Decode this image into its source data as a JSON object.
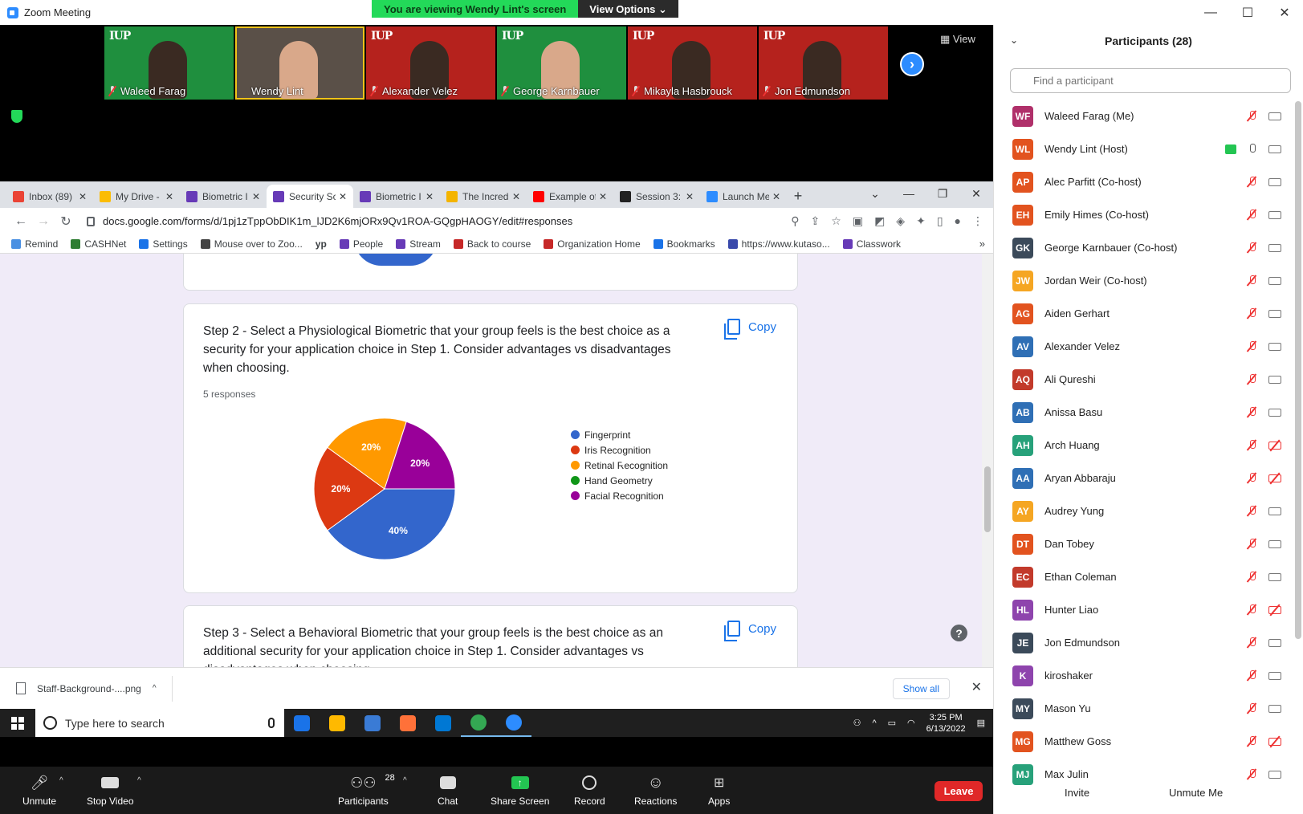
{
  "zoom": {
    "window_title": "Zoom Meeting",
    "banner_text": "You are viewing Wendy Lint's screen",
    "view_options": "View Options",
    "view_label": "View",
    "min": "—",
    "max": "☐",
    "close": "✕"
  },
  "thumbnails": [
    {
      "name": "Waleed Farag",
      "bg": "green",
      "iup": "IUP",
      "light": false,
      "speaking": false,
      "muted": true
    },
    {
      "name": "Wendy Lint",
      "bg": "room",
      "iup": "",
      "light": true,
      "speaking": true,
      "muted": false
    },
    {
      "name": "Alexander Velez",
      "bg": "red",
      "iup": "IUP",
      "light": false,
      "speaking": false,
      "muted": true
    },
    {
      "name": "George Karnbauer",
      "bg": "green",
      "iup": "IUP",
      "light": true,
      "speaking": false,
      "muted": true
    },
    {
      "name": "Mikayla Hasbrouck",
      "bg": "red",
      "iup": "IUP",
      "light": false,
      "speaking": false,
      "muted": true
    },
    {
      "name": "Jon Edmundson",
      "bg": "red",
      "iup": "IUP",
      "light": false,
      "speaking": false,
      "muted": true
    }
  ],
  "browser": {
    "tabs": [
      {
        "label": "Inbox (89)",
        "color": "#ea4335",
        "active": false
      },
      {
        "label": "My Drive -",
        "color": "#fbbc04",
        "active": false
      },
      {
        "label": "Biometric I",
        "color": "#673ab7",
        "active": false
      },
      {
        "label": "Security Sc",
        "color": "#673ab7",
        "active": true
      },
      {
        "label": "Biometric I",
        "color": "#673ab7",
        "active": false
      },
      {
        "label": "The Incred",
        "color": "#f4b400",
        "active": false
      },
      {
        "label": "Example of",
        "color": "#ff0000",
        "active": false
      },
      {
        "label": "Session 3:",
        "color": "#222222",
        "active": false
      },
      {
        "label": "Launch Me",
        "color": "#2d8cff",
        "active": false
      }
    ],
    "new_tab": "+",
    "url": "docs.google.com/forms/d/1pj1zTppObDIK1m_lJD2K6mjORx9Qv1ROA-GQgpHAOGY/edit#responses",
    "bookmarks": [
      {
        "label": "Remind",
        "color": "#4a90e2"
      },
      {
        "label": "CASHNet",
        "color": "#2e7d32"
      },
      {
        "label": "Settings",
        "color": "#1a73e8"
      },
      {
        "label": "Mouse over to Zoo...",
        "color": "#444444"
      },
      {
        "label": "",
        "color": "#222222",
        "text": "yp"
      },
      {
        "label": "People",
        "color": "#673ab7"
      },
      {
        "label": "Stream",
        "color": "#673ab7"
      },
      {
        "label": "Back to course",
        "color": "#c62828"
      },
      {
        "label": "Organization Home",
        "color": "#c62828"
      },
      {
        "label": "Bookmarks",
        "color": "#1a73e8"
      },
      {
        "label": "https://www.kutaso...",
        "color": "#3949ab"
      },
      {
        "label": "Classwork",
        "color": "#673ab7"
      }
    ],
    "bookmarks_more": "»"
  },
  "form": {
    "step2": {
      "question": "Step 2 - Select a Physiological Biometric that your group feels is the best choice as a security for your  application choice in Step 1. Consider advantages vs disadvantages when choosing.",
      "responses": "5 responses",
      "copy_label": "Copy"
    },
    "step3": {
      "question": "Step 3 - Select a Behavioral Biometric that your group feels is the best choice as an additional security for your  application choice in Step 1. Consider advantages vs disadvantages when choosing.",
      "copy_label": "Copy"
    },
    "help": "?"
  },
  "chart_data": {
    "type": "pie",
    "categories": [
      "Fingerprint",
      "Iris Recognition",
      "Retinal Recognition",
      "Hand Geometry",
      "Facial Recognition"
    ],
    "values": [
      40,
      20,
      20,
      0,
      20
    ],
    "labels": [
      "40%",
      "20%",
      "20%",
      "",
      "20%"
    ],
    "colors": [
      "#3366cc",
      "#dc3912",
      "#ff9900",
      "#109618",
      "#990099"
    ],
    "legend_position": "right"
  },
  "download": {
    "filename": "Staff-Background-....png",
    "show_all": "Show all",
    "close": "✕"
  },
  "taskbar": {
    "search_placeholder": "Type here to search",
    "time": "3:25 PM",
    "date": "6/13/2022",
    "apps": [
      "#1a73e8",
      "#ffb900",
      "#3a7bd5",
      "#ff7139",
      "#0078d4",
      "#34a853",
      "#2d8cff"
    ]
  },
  "controls": {
    "unmute": "Unmute",
    "stop_video": "Stop Video",
    "participants": "Participants",
    "participants_count": "28",
    "chat": "Chat",
    "share_screen": "Share Screen",
    "record": "Record",
    "reactions": "Reactions",
    "apps": "Apps",
    "leave": "Leave"
  },
  "panel": {
    "title": "Participants (28)",
    "search_placeholder": "Find a participant",
    "invite": "Invite",
    "unmute_me": "Unmute Me",
    "participants": [
      {
        "initials": "WF",
        "name": "Waleed Farag (Me)",
        "color": "#b0306a",
        "cam_off": false,
        "share": false
      },
      {
        "initials": "WL",
        "name": "Wendy Lint (Host)",
        "color": "#e2531f",
        "cam_off": false,
        "share": true
      },
      {
        "initials": "AP",
        "name": "Alec Parfitt (Co-host)",
        "color": "#e2531f",
        "cam_off": false,
        "share": false
      },
      {
        "initials": "EH",
        "name": "Emily Himes (Co-host)",
        "color": "#e2531f",
        "cam_off": false,
        "share": false
      },
      {
        "initials": "GK",
        "name": "George Karnbauer (Co-host)",
        "color": "#3b4a5a",
        "cam_off": false,
        "share": false
      },
      {
        "initials": "JW",
        "name": "Jordan Weir (Co-host)",
        "color": "#f5a623",
        "cam_off": false,
        "share": false
      },
      {
        "initials": "AG",
        "name": "Aiden Gerhart",
        "color": "#e2531f",
        "cam_off": false,
        "share": false
      },
      {
        "initials": "AV",
        "name": "Alexander Velez",
        "color": "#2f6fb5",
        "cam_off": false,
        "share": false
      },
      {
        "initials": "AQ",
        "name": "Ali Qureshi",
        "color": "#c23a2b",
        "cam_off": false,
        "share": false
      },
      {
        "initials": "AB",
        "name": "Anissa Basu",
        "color": "#2f6fb5",
        "cam_off": false,
        "share": false
      },
      {
        "initials": "AH",
        "name": "Arch Huang",
        "color": "#27a17a",
        "cam_off": true,
        "share": false
      },
      {
        "initials": "AA",
        "name": "Aryan Abbaraju",
        "color": "#2f6fb5",
        "cam_off": true,
        "share": false
      },
      {
        "initials": "AY",
        "name": "Audrey Yung",
        "color": "#f5a623",
        "cam_off": false,
        "share": false
      },
      {
        "initials": "DT",
        "name": "Dan Tobey",
        "color": "#e2531f",
        "cam_off": false,
        "share": false
      },
      {
        "initials": "EC",
        "name": "Ethan Coleman",
        "color": "#c23a2b",
        "cam_off": false,
        "share": false
      },
      {
        "initials": "HL",
        "name": "Hunter Liao",
        "color": "#8e44ad",
        "cam_off": true,
        "share": false
      },
      {
        "initials": "JE",
        "name": "Jon Edmundson",
        "color": "#3b4a5a",
        "cam_off": false,
        "share": false
      },
      {
        "initials": "K",
        "name": "kiroshaker",
        "color": "#8e44ad",
        "cam_off": false,
        "share": false
      },
      {
        "initials": "MY",
        "name": "Mason Yu",
        "color": "#3b4a5a",
        "cam_off": false,
        "share": false
      },
      {
        "initials": "MG",
        "name": "Matthew Goss",
        "color": "#e2531f",
        "cam_off": true,
        "share": false
      },
      {
        "initials": "MJ",
        "name": "Max Julin",
        "color": "#27a17a",
        "cam_off": false,
        "share": false
      }
    ]
  }
}
